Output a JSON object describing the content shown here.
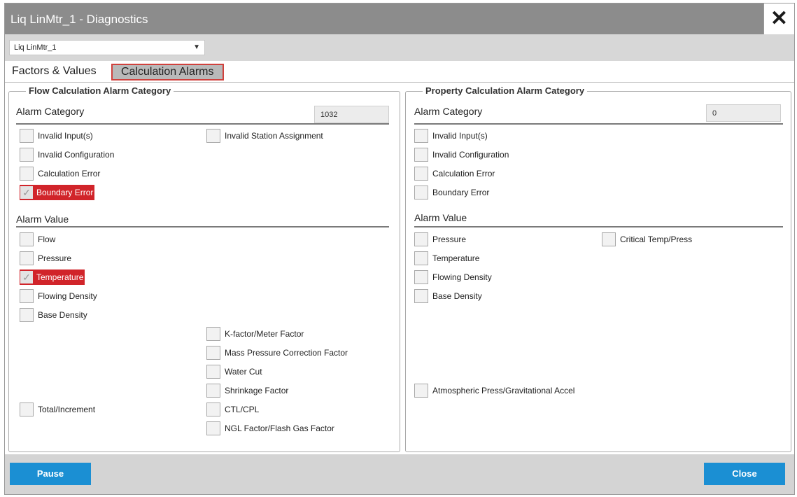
{
  "window": {
    "title": "Liq LinMtr_1 - Diagnostics",
    "close_glyph": "✕"
  },
  "meter_select": {
    "value": "Liq LinMtr_1",
    "arrow": "▼"
  },
  "tabs": [
    {
      "label": "Factors & Values",
      "active": false
    },
    {
      "label": "Calculation Alarms",
      "active": true
    }
  ],
  "flow": {
    "legend": "Flow Calculation Alarm Category",
    "category_label": "Alarm Category",
    "category_count": "1032",
    "categories": {
      "invalid_inputs": "Invalid Input(s)",
      "invalid_station": "Invalid Station Assignment",
      "invalid_config": "Invalid Configuration",
      "calc_error": "Calculation Error",
      "boundary_error": "Boundary Error"
    },
    "value_label": "Alarm Value",
    "values": {
      "flow": "Flow",
      "pressure": "Pressure",
      "temperature": "Temperature",
      "flowing_density": "Flowing Density",
      "base_density": "Base Density",
      "k_factor": "K-factor/Meter Factor",
      "mass_pressure": "Mass Pressure Correction Factor",
      "water_cut": "Water Cut",
      "shrinkage": "Shrinkage Factor",
      "total_increment": "Total/Increment",
      "ctl_cpl": "CTL/CPL",
      "ngl_factor": "NGL Factor/Flash Gas Factor"
    }
  },
  "property": {
    "legend": "Property Calculation Alarm Category",
    "category_label": "Alarm Category",
    "category_count": "0",
    "categories": {
      "invalid_inputs": "Invalid Input(s)",
      "invalid_config": "Invalid Configuration",
      "calc_error": "Calculation Error",
      "boundary_error": "Boundary Error"
    },
    "value_label": "Alarm Value",
    "values": {
      "pressure": "Pressure",
      "critical_temp": "Critical Temp/Press",
      "temperature": "Temperature",
      "flowing_density": "Flowing Density",
      "base_density": "Base Density",
      "atmospheric": "Atmospheric Press/Gravitational Accel"
    }
  },
  "footer": {
    "pause_label": "Pause",
    "close_label": "Close"
  },
  "colors": {
    "alarm": "#d1242a",
    "button": "#1b8fd3",
    "titlebar": "#8c8c8c"
  },
  "icons": {
    "check": "✓"
  }
}
